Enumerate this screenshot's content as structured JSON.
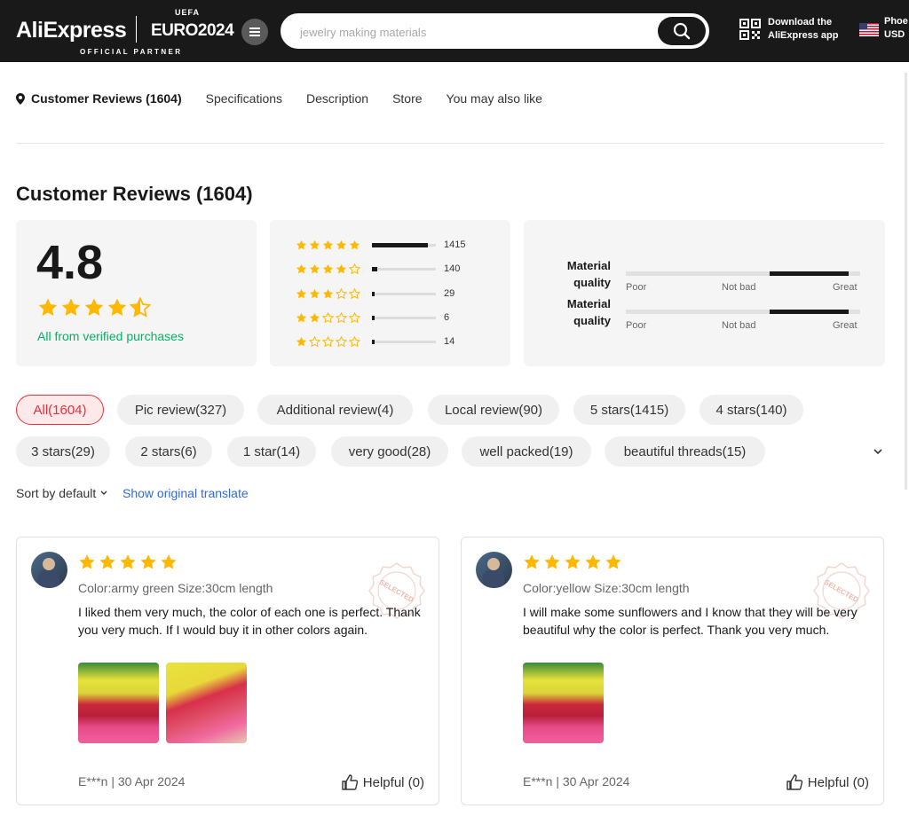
{
  "header": {
    "logo": "AliExpress",
    "euro_uefa": "UEFA",
    "euro": "EURO2024",
    "partner": "OFFICIAL PARTNER",
    "search_placeholder": "jewelry making materials",
    "app_line1": "Download the",
    "app_line2": "AliExpress app",
    "locale_line1": "Phoe",
    "locale_line2": "USD"
  },
  "nav": {
    "items": [
      "Customer Reviews (1604)",
      "Specifications",
      "Description",
      "Store",
      "You may also like"
    ]
  },
  "reviews_summary": {
    "title": "Customer Reviews (1604)",
    "rating": "4.8",
    "rating_value": 4.8,
    "verified": "All from verified purchases",
    "distribution": [
      {
        "stars": 5,
        "count": "1415",
        "fraction": 0.88
      },
      {
        "stars": 4,
        "count": "140",
        "fraction": 0.09
      },
      {
        "stars": 3,
        "count": "29",
        "fraction": 0.02
      },
      {
        "stars": 2,
        "count": "6",
        "fraction": 0.01
      },
      {
        "stars": 1,
        "count": "14",
        "fraction": 0.01
      }
    ],
    "quality": [
      {
        "label_line1": "Material",
        "label_line2": "quality",
        "ticks": [
          "Poor",
          "Not bad",
          "Great"
        ]
      },
      {
        "label_line1": "Material",
        "label_line2": "quality",
        "ticks": [
          "Poor",
          "Not bad",
          "Great"
        ]
      }
    ]
  },
  "filters": {
    "chips": [
      "All(1604)",
      "Pic review(327)",
      "Additional review(4)",
      "Local review(90)",
      "5 stars(1415)",
      "4 stars(140)",
      "3 stars(29)",
      "2 stars(6)",
      "1 star(14)",
      "very good(28)",
      "well packed(19)",
      "beautiful threads(15)"
    ],
    "active_index": 0
  },
  "sort": {
    "label": "Sort by default",
    "translate": "Show original translate"
  },
  "reviews": [
    {
      "stars": 5,
      "badge": "SELECTED",
      "variant": "Color:army green Size:30cm length",
      "text": "I liked them very much, the color of each one is perfect. Thank you very much. If I would buy it in other colors again.",
      "user_date": "E***n | 30 Apr 2024",
      "helpful": "Helpful (0)"
    },
    {
      "stars": 5,
      "badge": "SELECTED",
      "variant": "Color:yellow Size:30cm length",
      "text": "I will make some sunflowers and I know that they will be very beautiful why the color is perfect. Thank you very much.",
      "user_date": "E***n | 30 Apr 2024",
      "helpful": "Helpful (0)"
    }
  ],
  "colors": {
    "star": "#FFB800",
    "verified": "#00B464",
    "accent": "#EE2C3A",
    "link": "#2E6BDE",
    "header_bg": "#191919"
  }
}
